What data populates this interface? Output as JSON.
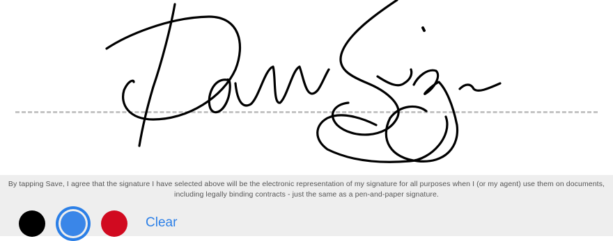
{
  "signature_pad": {
    "ink_color": "#000000",
    "baseline_color": "#c4c4c4"
  },
  "footer": {
    "consent_line1": "By tapping Save, I agree that the signature I have selected above will be the electronic representation of my signature for all purposes when I (or my agent) use them on documents,",
    "consent_line2": "including legally binding contracts - just the same as a pen-and-paper signature.",
    "clear_label": "Clear",
    "colors": [
      {
        "name": "black",
        "hex": "#000000",
        "selected": false
      },
      {
        "name": "blue",
        "hex": "#3a86e8",
        "selected": true
      },
      {
        "name": "red",
        "hex": "#d10a20",
        "selected": false
      }
    ]
  }
}
